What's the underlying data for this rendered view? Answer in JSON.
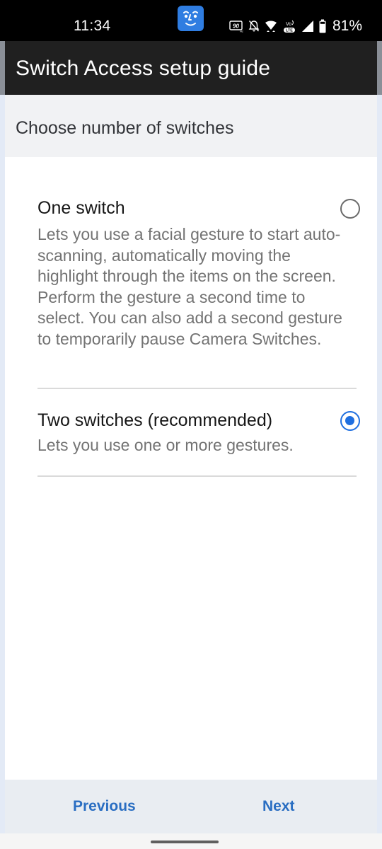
{
  "status_bar": {
    "time": "11:34",
    "app_notification_icon": "face-gesture-icon",
    "icons": [
      "refresh-rate-90hz-icon",
      "notifications-off-icon",
      "wifi-icon",
      "volte-lte-icon",
      "cell-signal-icon",
      "battery-icon"
    ],
    "refresh_rate_label": "90",
    "battery_percent": "81%"
  },
  "app_bar": {
    "title": "Switch Access setup guide"
  },
  "section": {
    "title": "Choose number of switches"
  },
  "options": [
    {
      "title": "One switch",
      "description": "Lets you use a facial gesture to start auto-scanning, automatically moving the highlight through the items on the screen. Perform the gesture a second time to select. You can also add a second gesture to temporarily pause Camera Switches.",
      "selected": false
    },
    {
      "title": "Two switches (recommended)",
      "description": "Lets you use one or more gestures.",
      "selected": true
    }
  ],
  "colors": {
    "accent": "#1f6fe0",
    "button_text": "#2a6ec2",
    "app_bar_bg": "#202020"
  },
  "buttons": {
    "previous": "Previous",
    "next": "Next"
  }
}
